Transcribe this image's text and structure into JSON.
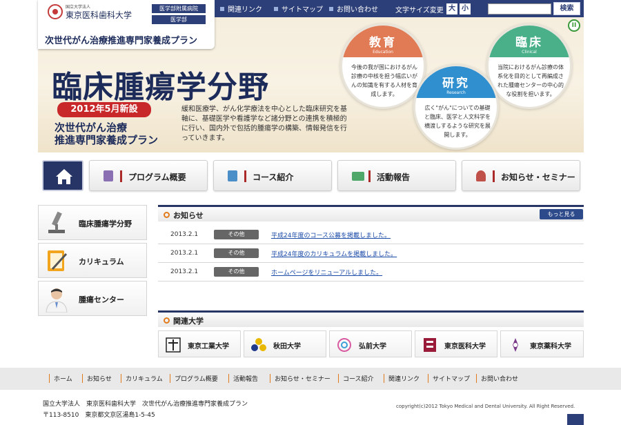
{
  "topnav": {
    "links": [
      "関連リンク",
      "サイトマップ",
      "お問い合わせ"
    ],
    "font_size_label": "文字サイズ変更",
    "font_large": "大",
    "font_small": "小",
    "search_button": "検索",
    "search_value": ""
  },
  "logo": {
    "small": "国立大学法人",
    "university": "東京医科歯科大学",
    "badge_hospital": "医学部附属病院",
    "badge_faculty": "医学部",
    "plan": "次世代がん治療推進専門家養成プラン"
  },
  "hero": {
    "title": "臨床腫瘍学分野",
    "new_badge": "2012年5月新設",
    "plan_line1": "次世代がん治療",
    "plan_line2": "推進専門家養成プラン",
    "description": "緩和医療学、がん化学療法を中心とした臨床研究を基軸に、基礎医学や看護学など諸分野との連携を積極的に行い、国内外で包括的腫瘍学の構築、情報発信を行っていきます。",
    "circles": [
      {
        "title": "教育",
        "subtitle": "Education",
        "text": "今後の我が国におけるがん診療の中核を担う幅広いがんの知識を有する人材を育成します。",
        "color": "#e07b56"
      },
      {
        "title": "研究",
        "subtitle": "Research",
        "text": "広く\"がん\"についての基礎と臨床、医学と人文科学を横渡しするような研究を展開します。",
        "color": "#2f8fcf"
      },
      {
        "title": "臨床",
        "subtitle": "Clinical",
        "text": "当院におけるがん診療の体系化を目的として再編成された腫瘍センターの中心的な役割を担います。",
        "color": "#49b08a"
      }
    ],
    "pause_icon": "pause-icon"
  },
  "mainnav": [
    "プログラム概要",
    "コース紹介",
    "活動報告",
    "お知らせ・セミナー"
  ],
  "sidebar": [
    "臨床腫瘍学分野",
    "カリキュラム",
    "腫瘍センター"
  ],
  "news": {
    "heading": "お知らせ",
    "more": "もっと見る",
    "items": [
      {
        "date": "2013.2.1",
        "category": "その他",
        "title": "平成24年度のコース公募を掲載しました。"
      },
      {
        "date": "2013.2.1",
        "category": "その他",
        "title": "平成24年度のカリキュラムを掲載しました。"
      },
      {
        "date": "2013.2.1",
        "category": "その他",
        "title": "ホームページをリニューアルしました。"
      }
    ]
  },
  "related": {
    "heading": "関連大学",
    "items": [
      "東京工業大学",
      "秋田大学",
      "弘前大学",
      "東京医科大学",
      "東京薬科大学"
    ]
  },
  "footer": {
    "links": [
      "ホーム",
      "お知らせ",
      "カリキュラム",
      "プログラム概要",
      "活動報告",
      "お知らせ・セミナー",
      "コース紹介",
      "関連リンク",
      "サイトマップ",
      "お問い合わせ"
    ],
    "org": "国立大学法人　東京医科歯科大学　次世代がん治療推進専門家養成プラン",
    "address": "〒113-8510　東京都文京区湯島1-5-45",
    "copyright": "copyright(c)2012 Tokyo Medical and Dental University. All Right Reserved."
  },
  "colors": {
    "navy": "#2d3f78",
    "accent_red": "#c8282a",
    "link_blue": "#1a4aa8",
    "bullet_orange": "#e07a1a"
  }
}
